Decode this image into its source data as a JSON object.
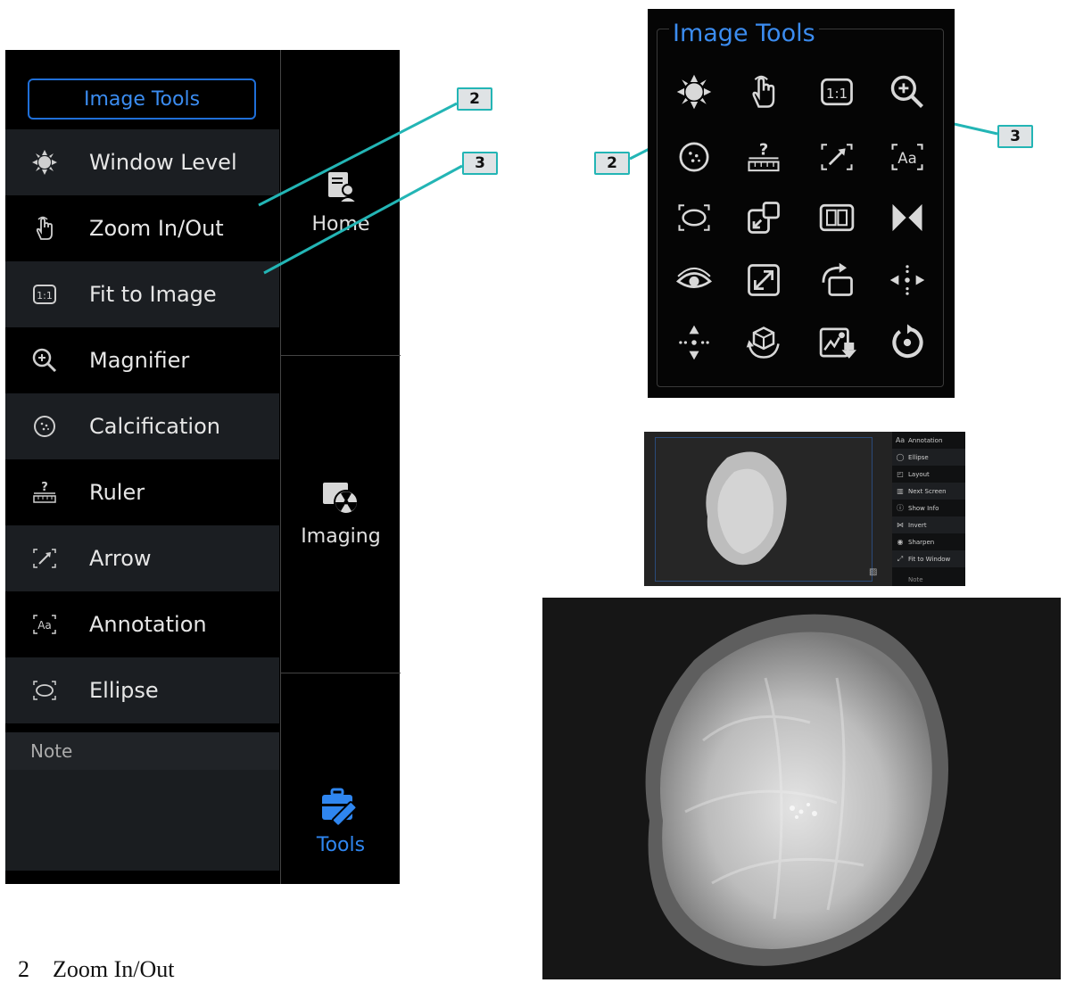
{
  "left_panel": {
    "header": "Image Tools",
    "items": [
      {
        "label": "Window Level",
        "icon": "sun-icon"
      },
      {
        "label": "Zoom In/Out",
        "icon": "hand-pointer-icon"
      },
      {
        "label": "Fit to Image",
        "icon": "one-to-one-icon"
      },
      {
        "label": "Magnifier",
        "icon": "zoom-in-icon"
      },
      {
        "label": "Calcification",
        "icon": "calcification-icon"
      },
      {
        "label": "Ruler",
        "icon": "ruler-icon"
      },
      {
        "label": "Arrow",
        "icon": "arrow-icon"
      },
      {
        "label": "Annotation",
        "icon": "annotation-icon"
      },
      {
        "label": "Ellipse",
        "icon": "ellipse-icon"
      }
    ],
    "note_label": "Note"
  },
  "side_nav": {
    "home": "Home",
    "imaging": "Imaging",
    "tools": "Tools"
  },
  "grid_panel": {
    "title": "Image Tools",
    "icons": [
      "sun-icon",
      "hand-pointer-icon",
      "one-to-one-icon",
      "zoom-in-icon",
      "calcification-icon",
      "ruler-icon",
      "arrow-icon",
      "annotation-icon",
      "ellipse-icon",
      "layout-icon",
      "next-screen-icon",
      "invert-icon",
      "eye-icon",
      "fit-window-icon",
      "rotate-icon",
      "pan-icon",
      "move-icon",
      "3d-rotate-icon",
      "image-export-icon",
      "reset-icon"
    ]
  },
  "callouts": {
    "left_a": "2",
    "left_b": "3",
    "grid_a": "2",
    "grid_b": "3"
  },
  "thumbnail_menu": [
    {
      "label": "Annotation"
    },
    {
      "label": "Ellipse"
    },
    {
      "label": "Layout"
    },
    {
      "label": "Next Screen"
    },
    {
      "label": "Show Info"
    },
    {
      "label": "Invert"
    },
    {
      "label": "Sharpen"
    },
    {
      "label": "Fit to Window"
    },
    {
      "label": "Note"
    }
  ],
  "caption": {
    "number": "2",
    "text": "Zoom In/Out"
  },
  "colors": {
    "accent": "#3b8cf0",
    "callout_border": "#23b5b5",
    "panel_bg": "#000000"
  }
}
